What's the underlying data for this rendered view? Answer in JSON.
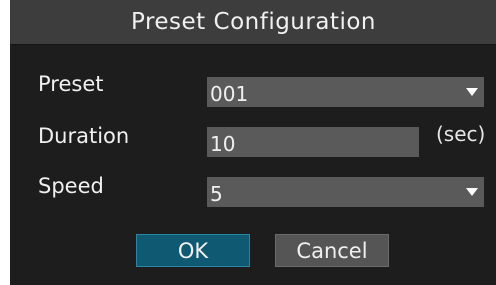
{
  "dialog": {
    "title": "Preset Configuration",
    "fields": {
      "preset": {
        "label": "Preset",
        "value": "001",
        "icon": "dropdown-arrow-icon"
      },
      "duration": {
        "label": "Duration",
        "value": "10",
        "unit": "(sec)"
      },
      "speed": {
        "label": "Speed",
        "value": "5",
        "icon": "dropdown-arrow-icon"
      }
    },
    "buttons": {
      "ok_label": "OK",
      "cancel_label": "Cancel"
    },
    "colors": {
      "background": "#1d1d1d",
      "titlebar": "#3d3d3d",
      "field": "#5a5a5a",
      "ok_button": "#0f5a72",
      "cancel_button": "#555555"
    }
  }
}
